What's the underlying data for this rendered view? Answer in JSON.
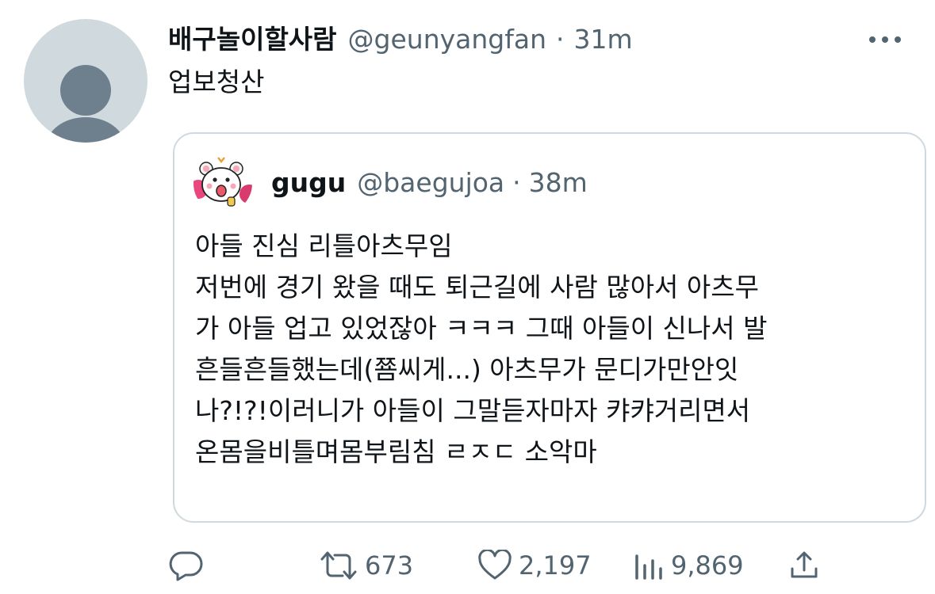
{
  "tweet": {
    "display_name": "배구놀이할사람",
    "handle": "@geunyangfan",
    "separator": "·",
    "time": "31m",
    "text": "업보청산",
    "more_icon": "more-horizontal-icon"
  },
  "quote": {
    "display_name": "gugu",
    "handle": "@baegujoa",
    "separator": "·",
    "time": "38m",
    "lines": [
      "아들 진심 리틀아츠무임",
      "저번에 경기 왔을 때도 퇴근길에 사람 많아서 아츠무",
      "가 아들 업고 있었잖아 ㅋㅋㅋ 그때 아들이 신나서 발",
      "흔들흔들했는데(쬼씨게...) 아츠무가 문디가만안잇",
      "나?!?!이러니가 아들이 그말듣자마자 캬캬거리면서",
      "온몸을비틀며몸부림침 ㄹㅈㄷ 소악마"
    ]
  },
  "actions": {
    "reply_icon": "reply-icon",
    "retweet_icon": "retweet-icon",
    "retweet_count": "673",
    "like_icon": "heart-icon",
    "like_count": "2,197",
    "views_icon": "views-chart-icon",
    "views_count": "9,869",
    "share_icon": "share-icon"
  },
  "colors": {
    "text_primary": "#0f1419",
    "text_secondary": "#536471",
    "border": "#cfd9de",
    "avatar_placeholder": "#cfd9de",
    "avatar_silhouette": "#6e7f8d"
  }
}
